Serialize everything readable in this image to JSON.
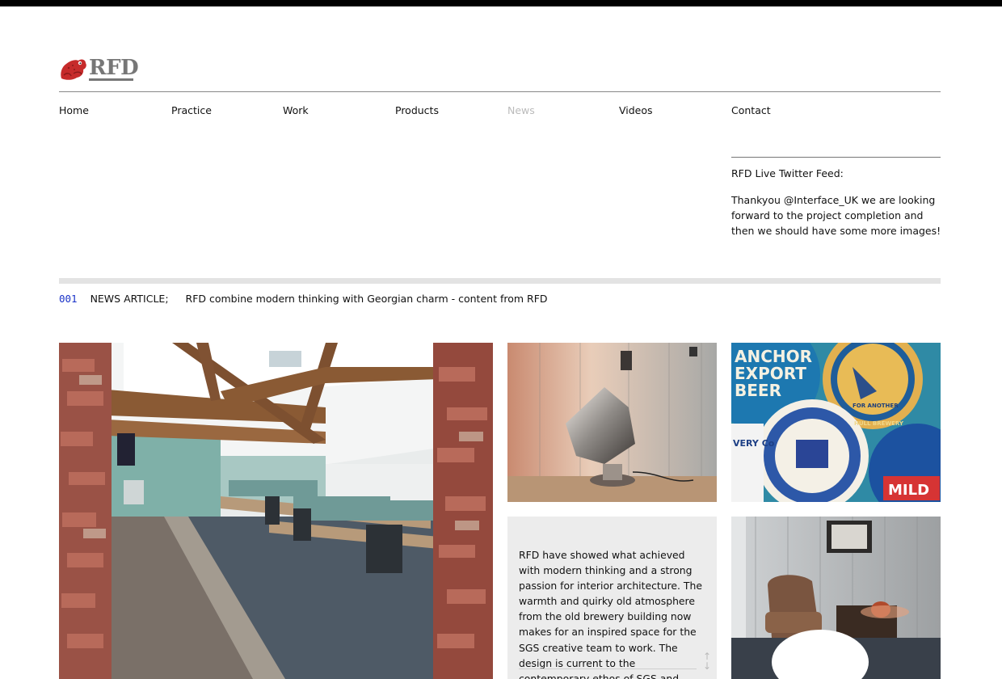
{
  "logo": {
    "text": "RFD"
  },
  "nav": {
    "items": [
      {
        "label": "Home"
      },
      {
        "label": "Practice"
      },
      {
        "label": "Work"
      },
      {
        "label": "Products"
      },
      {
        "label": "News"
      },
      {
        "label": "Videos"
      },
      {
        "label": "Contact"
      }
    ],
    "active_color": "#bbbbbb"
  },
  "twitter": {
    "title": "RFD Live Twitter Feed:",
    "tweet": "Thankyou @Interface_UK we are looking forward to the project completion and then we should have some more images!"
  },
  "article": {
    "number": "001",
    "label": "NEWS ARTICLE;",
    "title": "RFD combine modern thinking with Georgian charm - content from RFD",
    "number_color": "#1a33c8",
    "body": "RFD have showed what achieved with modern thinking and a strong passion for interior architecture. The warmth and quirky old atmosphere from the old brewery building now makes for an inspired space for the SGS creative team to work. The design is current to the contemporary ethos of SGS and",
    "scroll_up": "↑",
    "scroll_down": "↓"
  },
  "images": [
    {
      "icon": "office-interior-photo"
    },
    {
      "icon": "chrome-lamp-photo"
    },
    {
      "icon": "beer-coasters-photo",
      "coaster_texts": [
        "ANCHOR",
        "EXPORT",
        "BEER",
        "FOR ANOTHER",
        "HULL BREWERY",
        "MILD",
        "VERY Co"
      ]
    },
    {
      "icon": "lounge-chair-photo"
    }
  ]
}
